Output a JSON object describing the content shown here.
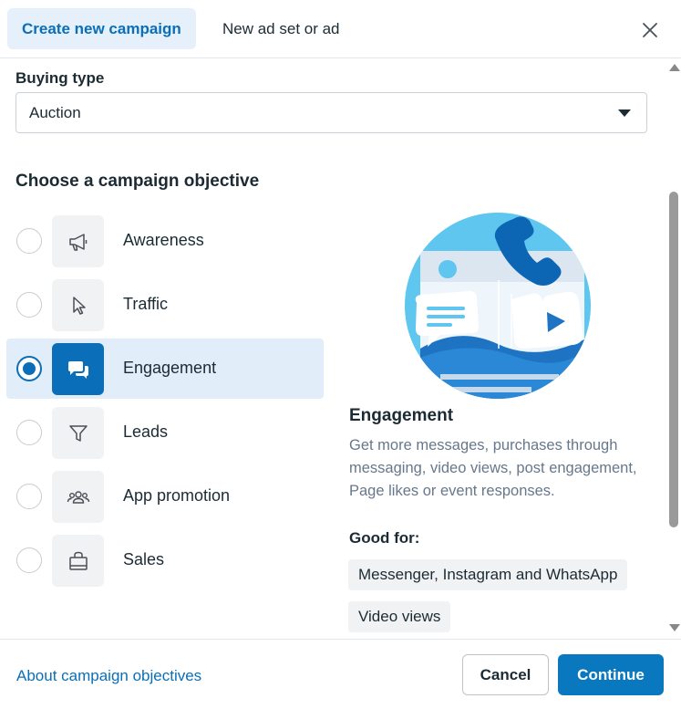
{
  "header": {
    "tabs": [
      {
        "label": "Create new campaign",
        "active": true
      },
      {
        "label": "New ad set or ad",
        "active": false
      }
    ],
    "close_icon": "close-icon"
  },
  "buying_type": {
    "label": "Buying type",
    "value": "Auction"
  },
  "objectives": {
    "title": "Choose a campaign objective",
    "items": [
      {
        "label": "Awareness",
        "icon": "megaphone-icon",
        "selected": false
      },
      {
        "label": "Traffic",
        "icon": "cursor-icon",
        "selected": false
      },
      {
        "label": "Engagement",
        "icon": "chat-bubbles-icon",
        "selected": true
      },
      {
        "label": "Leads",
        "icon": "funnel-icon",
        "selected": false
      },
      {
        "label": "App promotion",
        "icon": "people-icon",
        "selected": false
      },
      {
        "label": "Sales",
        "icon": "shopping-bag-icon",
        "selected": false
      }
    ]
  },
  "detail": {
    "title": "Engagement",
    "description": "Get more messages, purchases through messaging, video views, post engagement, Page likes or event responses.",
    "good_for_label": "Good for:",
    "good_for": [
      "Messenger, Instagram and WhatsApp",
      "Video views"
    ]
  },
  "footer": {
    "about_link": "About campaign objectives",
    "cancel_label": "Cancel",
    "continue_label": "Continue"
  },
  "colors": {
    "accent": "#0a6fb8",
    "selected_bg": "#e1edf8",
    "text": "#1c2b33",
    "muted_text": "#67788a"
  }
}
